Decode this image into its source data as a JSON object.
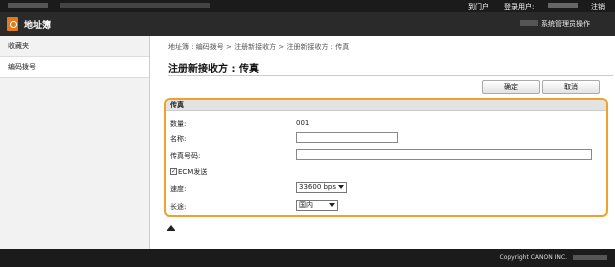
{
  "topbar": {
    "portal": "到门户",
    "user": "登录用户:",
    "logout": "注销"
  },
  "header": {
    "title": "地址簿",
    "to_system": "系统管理员操作"
  },
  "sidebar": {
    "items": [
      {
        "label": "收藏夹"
      },
      {
        "label": "编码拨号"
      }
    ]
  },
  "main": {
    "breadcrumb": "地址簿 : 编码拨号  >  注册新接收方  >  注册新接收方 : 传真",
    "title": "注册新接收方 : 传真",
    "ok_label": "确定",
    "cancel_label": "取消"
  },
  "form": {
    "section": "传真",
    "number_label": "数量:",
    "number_value": "001",
    "name_label": "名称:",
    "name_value": "",
    "fax_label": "传真号码:",
    "fax_value": "",
    "ecm_label": "ECM发送",
    "ecm_checked": true,
    "speed_label": "速度:",
    "speed_value": "33600 bps",
    "distance_label": "长途:",
    "distance_value": "国内"
  },
  "footer": {
    "copyright": "Copyright CANON INC."
  }
}
